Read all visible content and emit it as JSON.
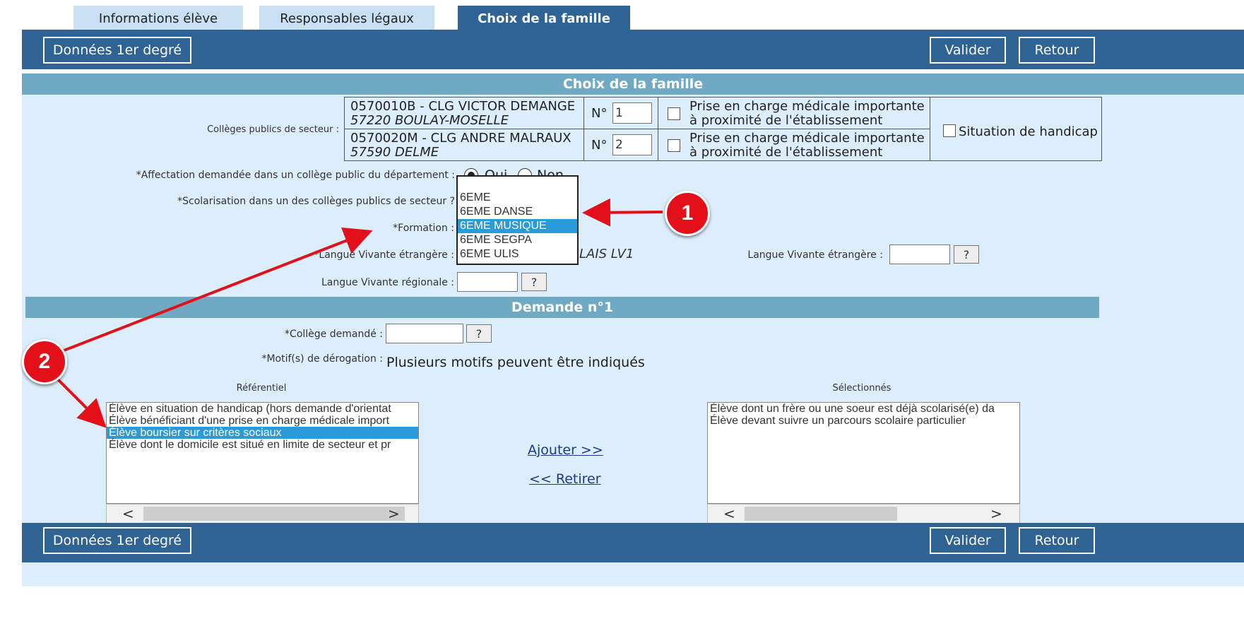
{
  "tabs": [
    {
      "label": "Informations élève"
    },
    {
      "label": "Responsables légaux"
    },
    {
      "label": "Choix de la famille"
    }
  ],
  "toolbar": {
    "donnees": "Données 1er degré",
    "valider": "Valider",
    "retour": "Retour"
  },
  "choix": {
    "title": "Choix de la famille",
    "colleges_label": "Collèges publics de secteur :",
    "colleges": [
      {
        "line1": "0570010B - CLG VICTOR DEMANGE",
        "line2": "57220 BOULAY-MOSELLE",
        "no_label": "N°",
        "no_value": "1",
        "medical": [
          "Prise en charge médicale importante",
          "à proximité de l'établissement"
        ]
      },
      {
        "line1": "0570020M - CLG ANDRE MALRAUX",
        "line2": "57590 DELME",
        "no_label": "N°",
        "no_value": "2",
        "medical": [
          "Prise en charge médicale importante",
          "à proximité de l'établissement"
        ]
      }
    ],
    "handicap": "Situation de handicap",
    "affectation_label": "*Affectation demandée dans un collège public du département :",
    "oui": "Oui",
    "non": "Non",
    "scolarisation_label": "*Scolarisation dans un des collèges publics de secteur ?",
    "formation_label": "*Formation :",
    "formation_options": [
      "",
      "6EME",
      "6EME DANSE",
      "6EME MUSIQUE",
      "6EME SEGPA",
      "6EME ULIS"
    ],
    "formation_selected_index": 3,
    "lv_label": "*Langue Vivante étrangère :",
    "lv_value": "ANGLAIS LV1",
    "lv_visible": "LAIS LV1",
    "lv2_label": "Langue Vivante étrangère :",
    "lvr_label": "Langue Vivante régionale :",
    "qmark": "?"
  },
  "demande": {
    "title": "Demande n°1",
    "college_label": "*Collège demandé :",
    "motif_label": "*Motif(s) de dérogation :",
    "motif_note": "Plusieurs motifs peuvent être indiqués",
    "referentiel_label": "Référentiel",
    "selectionnes_label": "Sélectionnés",
    "referentiel": [
      "Élève en situation de handicap (hors demande d'orientat",
      "Élève bénéficiant d'une prise en charge médicale import",
      "Élève boursier sur critères sociaux",
      "Élève dont le domicile est situé en limite de secteur et pr"
    ],
    "referentiel_selected_index": 2,
    "selectionnes": [
      "Élève dont un frère ou une soeur est déjà scolarisé(e) da",
      "Élève devant suivre un parcours scolaire particulier"
    ],
    "ajouter": "Ajouter >>",
    "retirer": "<< Retirer"
  },
  "annotations": [
    {
      "label": "1"
    },
    {
      "label": "2"
    }
  ],
  "colors": {
    "bar": "#2f6394",
    "section_header": "#6fa9c4",
    "content_bg": "#dcedfb",
    "selected": "#2b9ad8",
    "annotation": "#e3101a"
  }
}
